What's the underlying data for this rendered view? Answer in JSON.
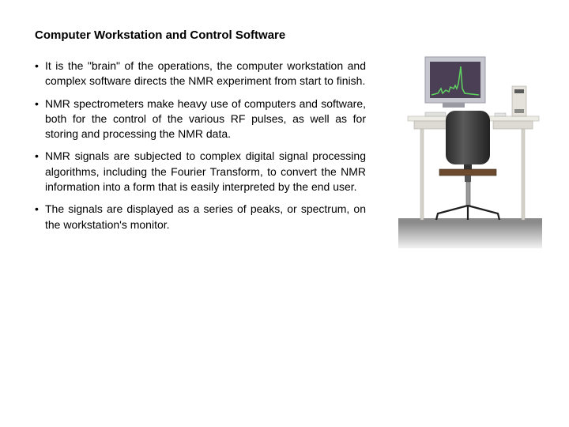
{
  "slide": {
    "title": "Computer Workstation and Control Software",
    "bullet_symbol": "•",
    "bullets": [
      "It is the \"brain\" of the operations, the computer workstation and complex software directs the NMR experiment from start to finish.",
      "NMR spectrometers make heavy use of computers and software, both for the control of the various RF pulses, as well as for storing and processing the NMR data.",
      "NMR signals are subjected to complex digital signal processing algorithms, including the Fourier Transform, to convert the NMR information into a form that is easily interpreted by the end user.",
      "The signals are displayed as a series of peaks, or spectrum, on the workstation's monitor."
    ]
  },
  "illustration": {
    "description": "computer workstation with desk, office chair and monitor showing NMR spectrum",
    "colors": {
      "screen": "#4a3f55",
      "spectrum": "#5fd35f",
      "monitor": "#c8c8d0",
      "desk": "#e6e4dc",
      "chair": "#3c3c3c",
      "seat": "#6b4a2e",
      "floor": "#9a9a9a"
    }
  }
}
